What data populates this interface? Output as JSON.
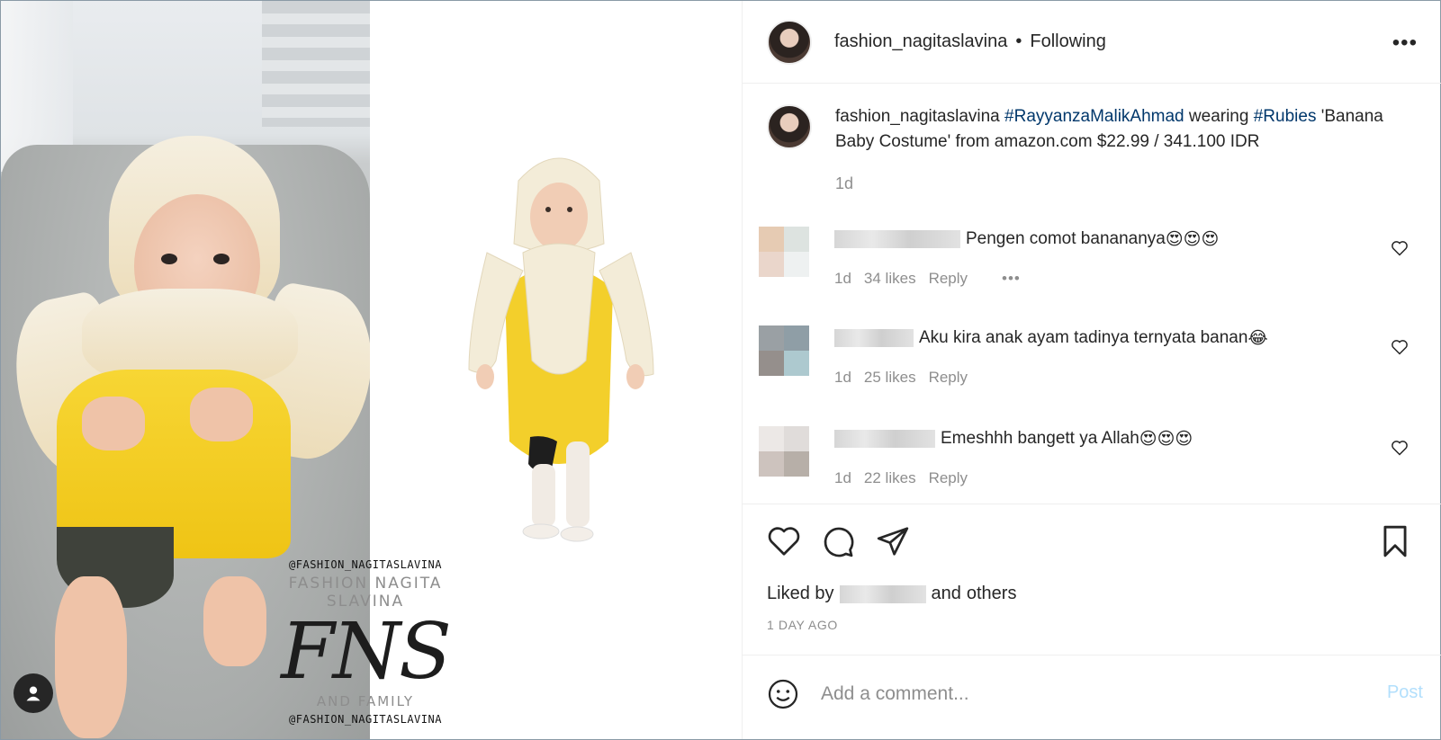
{
  "header": {
    "username": "fashion_nagitaslavina",
    "separator": "•",
    "follow_status": "Following",
    "more_label": "•••"
  },
  "caption": {
    "username": "fashion_nagitaslavina",
    "hashtag1": "#RayyanzaMalikAhmad",
    "middle": "wearing",
    "hashtag2": "#Rubies",
    "rest": "'Banana Baby Costume' from amazon.com $22.99 / 341.100 IDR",
    "time": "1d"
  },
  "comments": [
    {
      "text": "Pengen comot banananya",
      "emoji": "😍😍😍",
      "time": "1d",
      "likes": "34 likes",
      "reply": "Reply",
      "more": "•••"
    },
    {
      "text": "Aku kira anak ayam tadinya ternyata banan",
      "emoji": "😂",
      "time": "1d",
      "likes": "25 likes",
      "reply": "Reply"
    },
    {
      "text": "Emeshhh bangett ya Allah",
      "emoji": "😍😍😍",
      "time": "1d",
      "likes": "22 likes",
      "reply": "Reply"
    }
  ],
  "likes": {
    "prefix": "Liked by",
    "and": "and",
    "others": "others"
  },
  "post_time": "1 DAY AGO",
  "add_comment": {
    "placeholder": "Add a comment...",
    "post_label": "Post"
  },
  "watermark": {
    "handle_top": "@FASHION_NAGITASLAVINA",
    "title": "FASHION NAGITA SLAVINA",
    "logo": "FNS",
    "family": "AND FAMILY",
    "handle_bottom": "@FASHION_NAGITASLAVINA"
  },
  "colors": {
    "hashtag": "#00376b",
    "muted": "#8e8e8e",
    "post_disabled": "#b2dffc",
    "text": "#262626"
  }
}
